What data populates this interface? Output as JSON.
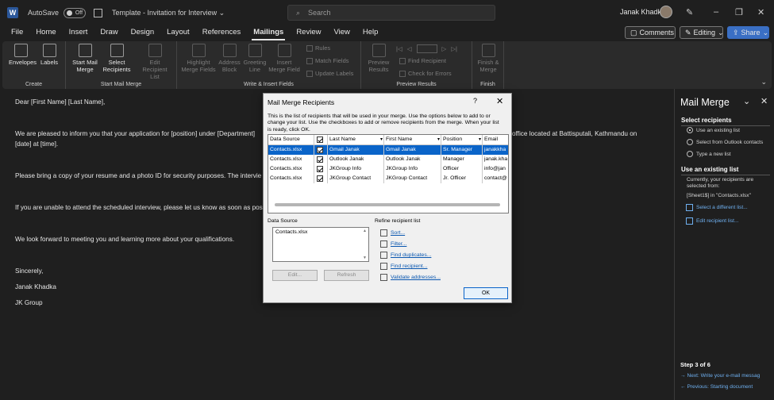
{
  "titlebar": {
    "autosave_label": "AutoSave",
    "autosave_state": "Off",
    "doc_title": "Template - Invitation for Interview",
    "search_placeholder": "Search",
    "user_name": "Janak Khadka"
  },
  "menu": [
    "File",
    "Home",
    "Insert",
    "Draw",
    "Design",
    "Layout",
    "References",
    "Mailings",
    "Review",
    "View",
    "Help"
  ],
  "menu_active": "Mailings",
  "top_buttons": {
    "comments": "Comments",
    "editing": "Editing",
    "share": "Share"
  },
  "ribbon": {
    "create_label": "Create",
    "envelopes": "Envelopes",
    "labels": "Labels",
    "start_group_label": "Start Mail Merge",
    "start_mail_merge": "Start Mail Merge",
    "select_recipients": "Select Recipients",
    "edit_recipient_list": "Edit Recipient List",
    "write_group_label": "Write & Insert Fields",
    "highlight_merge_fields": "Highlight Merge Fields",
    "address_block": "Address Block",
    "greeting_line": "Greeting Line",
    "insert_merge_field": "Insert Merge Field",
    "rules": "Rules",
    "match_fields": "Match Fields",
    "update_labels": "Update Labels",
    "preview_group_label": "Preview Results",
    "preview_results": "Preview Results",
    "find_recipient": "Find Recipient",
    "check_for_errors": "Check for Errors",
    "finish_group_label": "Finish",
    "finish_merge": "Finish & Merge"
  },
  "document": {
    "p1": "Dear [First Name] [Last Name],",
    "p2a": "We are pleased to inform you that your application for [position] under [Department]",
    "p2b": "office located at Battisputali, Kathmandu on",
    "p2c": "[date] at [time].",
    "p3": "Please bring a copy of your resume and a photo ID for security purposes. The intervie",
    "p4": "If you are unable to attend the scheduled interview, please let us know as soon as pos",
    "p5": "We look forward to meeting you and learning more about your qualifications.",
    "p6": "Sincerely,",
    "p7": "Janak Khadka",
    "p8": "JK Group"
  },
  "dialog": {
    "title": "Mail Merge Recipients",
    "help": "?",
    "close": "✕",
    "description": "This is the list of recipients that will be used in your merge.  Use the options below to add to or change your list.  Use the checkboxes to add or remove recipients from the merge.  When your list is ready, click OK.",
    "columns": [
      "Data Source",
      "",
      "Last Name",
      "First Name",
      "Position",
      "Email"
    ],
    "rows": [
      {
        "source": "Contacts.xlsx",
        "last": "Gmail Janak",
        "first": "Gmail Janak",
        "position": "Sr. Manager",
        "email": "janakkha"
      },
      {
        "source": "Contacts.xlsx",
        "last": "Outlook Janak",
        "first": "Outlook Janak",
        "position": "Manager",
        "email": "janak.kha"
      },
      {
        "source": "Contacts.xlsx",
        "last": "JKGroup Info",
        "first": "JKGroup Info",
        "position": "Officer",
        "email": "info@jan"
      },
      {
        "source": "Contacts.xlsx",
        "last": "JKGroup Contact",
        "first": "JKGroup Contact",
        "position": "Jr. Officer",
        "email": "contact@"
      }
    ],
    "data_source_label": "Data Source",
    "data_source_item": "Contacts.xlsx",
    "edit_button": "Edit...",
    "refresh_button": "Refresh",
    "refine_label": "Refine recipient list",
    "refine_links": [
      "Sort...",
      "Filter...",
      "Find duplicates...",
      "Find recipient...",
      "Validate addresses..."
    ],
    "ok_button": "OK"
  },
  "pane": {
    "title": "Mail Merge",
    "select_heading": "Select recipients",
    "options": [
      "Use an existing list",
      "Select from Outlook contacts",
      "Type a new list"
    ],
    "use_heading": "Use an existing list",
    "info1": "Currently, your recipients are",
    "info2": "selected from:",
    "info3": "[Sheet1$] in \"Contacts.xlsx\"",
    "link1": "Select a different list...",
    "link2": "Edit recipient list...",
    "step": "Step 3 of 6",
    "next": "Next: Write your e-mail messag",
    "prev": "Previous: Starting document"
  }
}
